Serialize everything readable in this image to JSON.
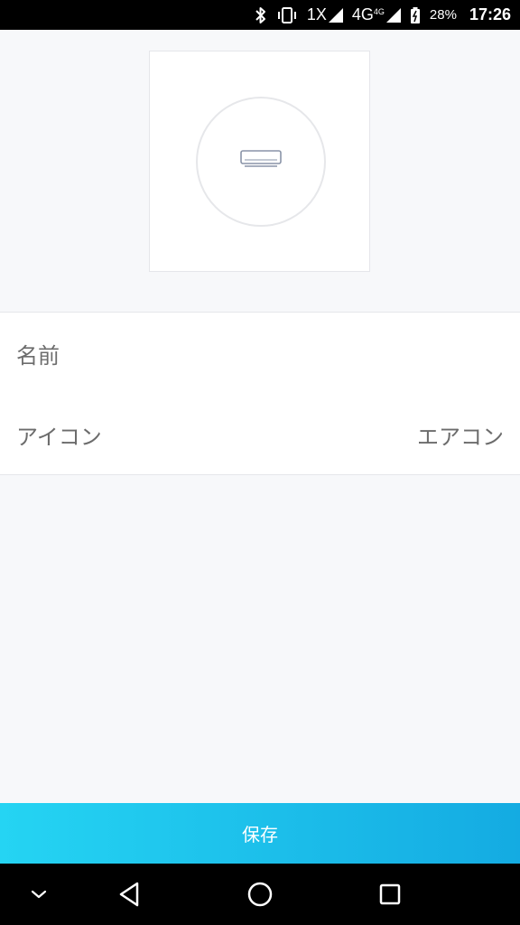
{
  "status_bar": {
    "network_label": "1X",
    "network_type": "4G",
    "network_type_small": "4G",
    "battery_percent": "28%",
    "time": "17:26",
    "icons": [
      "bluetooth-icon",
      "vibrate-icon",
      "signal-icon",
      "battery-charging-icon"
    ]
  },
  "icon_preview": {
    "icon": "air-conditioner-icon"
  },
  "settings": {
    "name_label": "名前",
    "name_value": "",
    "icon_label": "アイコン",
    "icon_value": "エアコン"
  },
  "save_button": {
    "label": "保存"
  },
  "nav_bar": {
    "icons": [
      "hide-keyboard-icon",
      "back-icon",
      "home-icon",
      "recents-icon"
    ]
  },
  "colors": {
    "accent_start": "#25d4f3",
    "accent_end": "#14abe2",
    "background": "#f7f8fa"
  }
}
